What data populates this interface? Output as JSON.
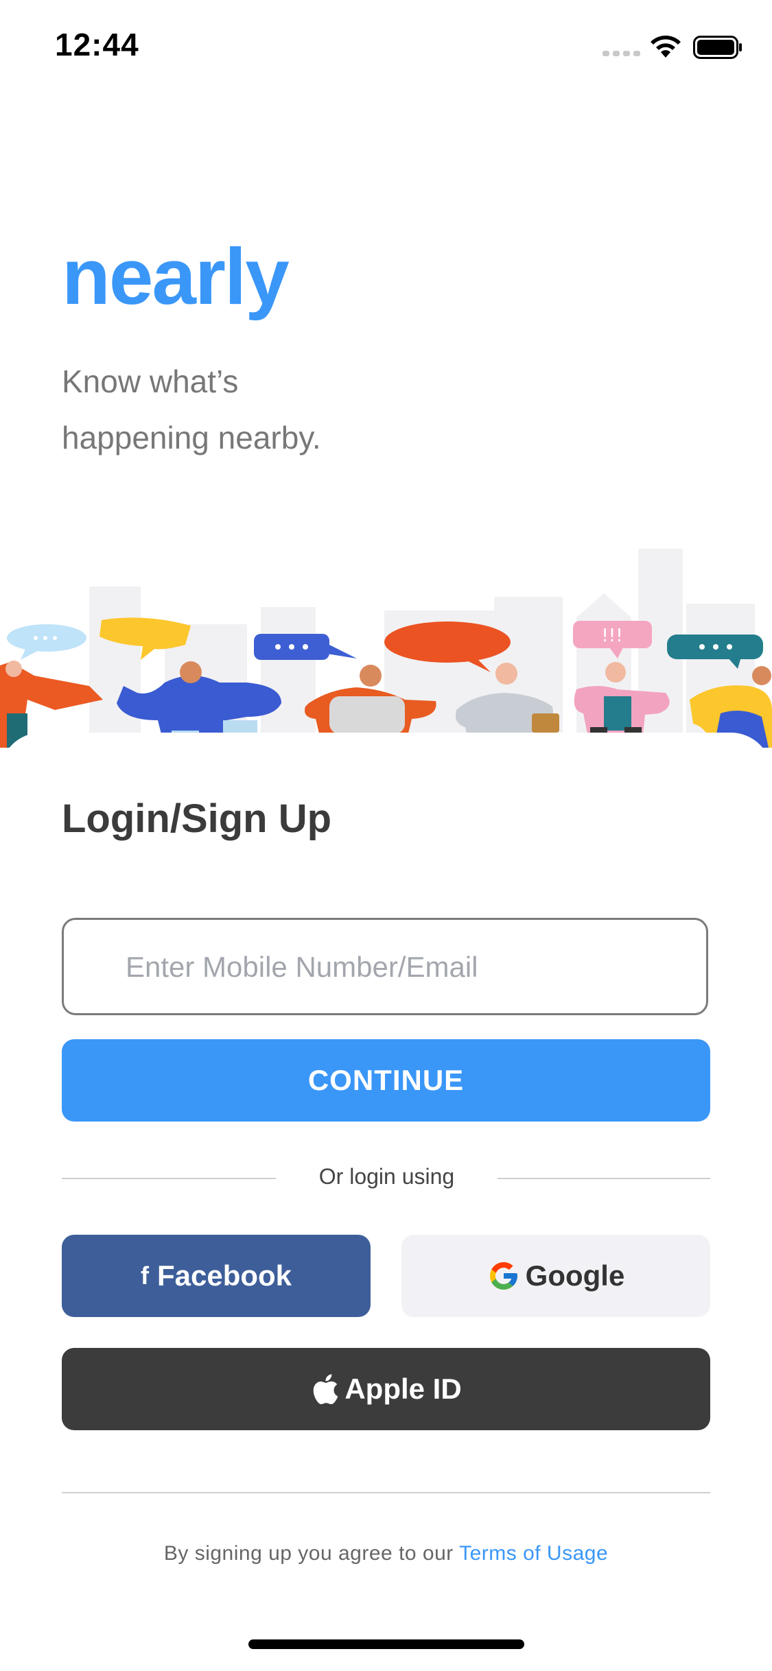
{
  "status_bar": {
    "time": "12:44"
  },
  "header": {
    "brand": "nearly",
    "tagline_line1": "Know what’s",
    "tagline_line2": "happening nearby."
  },
  "login": {
    "title": "Login/Sign Up",
    "input_placeholder": "Enter Mobile Number/Email",
    "input_value": "",
    "continue_label": "CONTINUE",
    "divider_text": "Or login using",
    "facebook_label": "Facebook",
    "google_label": "Google",
    "apple_label": "Apple ID"
  },
  "footer": {
    "terms_prefix": "By signing up you agree to our",
    "terms_link": "Terms of Usage"
  },
  "icons": {
    "signal": "cellular-signal-icon",
    "wifi": "wifi-icon",
    "battery": "battery-icon",
    "facebook": "facebook-icon",
    "google": "google-icon",
    "apple": "apple-icon"
  },
  "colors": {
    "accent": "#3a97f8",
    "facebook": "#3d5e99",
    "apple": "#3c3c3c",
    "google_bg": "#f2f2f6"
  }
}
